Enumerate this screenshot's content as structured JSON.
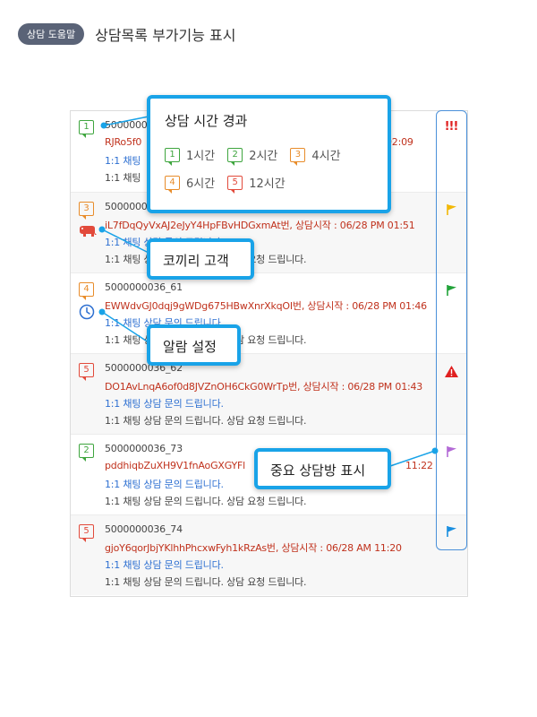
{
  "header": {
    "help_label": "상담 도움말",
    "title": "상담목록 부가기능 표시"
  },
  "items": [
    {
      "badge": "1",
      "id": "5000000036_",
      "name": "RJRo5f0",
      "time": "02:09",
      "msg1": "1:1 채팅",
      "msg2": "1:1 채팅"
    },
    {
      "badge": "3",
      "id": "5000000036_",
      "name": "iL7fDqQyVxAJ2eJyY4HpFBvHDGxmAt번, 상담시작 : 06/28 PM 01:51",
      "msg1": "1:1 채팅 상담 문의 드립니다.",
      "msg2": "1:1 채팅 상담 문의 드립니다. 상담 요청 드립니다."
    },
    {
      "badge": "4",
      "id": "5000000036_61",
      "name": "EWWdvGJ0dqj9gWDg675HBwXnrXkqOI번, 상담시작 : 06/28 PM 01:46",
      "msg1": "1:1 채팅 상담 문의 드립니다.",
      "msg2": "1:1 채팅 상담 문의 드립니다. 상담 요청 드립니다."
    },
    {
      "badge": "5",
      "id": "5000000036_62",
      "name": "DO1AvLnqA6of0d8JVZnOH6CkG0WrTp번, 상담시작 : 06/28 PM 01:43",
      "msg1": "1:1 채팅 상담 문의 드립니다.",
      "msg2": "1:1 채팅 상담 문의 드립니다. 상담 요청 드립니다."
    },
    {
      "badge": "2",
      "id": "5000000036_73",
      "name": "pddhiqbZuXH9V1fnAoGXGYFl",
      "time": "11:22",
      "msg1": "1:1 채팅 상담 문의 드립니다.",
      "msg2": "1:1 채팅 상담 문의 드립니다. 상담 요청 드립니다."
    },
    {
      "badge": "5",
      "id": "5000000036_74",
      "name": "gjoY6qorJbjYKlhhPhcxwFyh1kRzAs번, 상담시작 : 06/28 AM 11:20",
      "msg1": "1:1 채팅 상담 문의 드립니다.",
      "msg2": "1:1 채팅 상담 문의 드립니다. 상담 요청 드립니다."
    }
  ],
  "flags": {
    "exclaim": "!!!"
  },
  "callouts": {
    "time": {
      "title": "상담 시간 경과",
      "legend": [
        {
          "num": "1",
          "label": "1시간"
        },
        {
          "num": "2",
          "label": "2시간"
        },
        {
          "num": "3",
          "label": "4시간"
        },
        {
          "num": "4",
          "label": "6시간"
        },
        {
          "num": "5",
          "label": "12시간"
        }
      ]
    },
    "elephant": "코끼리 고객",
    "alarm": "알람 설정",
    "important": "중요 상담방 표시"
  },
  "colors": {
    "accent": "#19a3e8",
    "green": "#3ea53e",
    "orange": "#e88c2a",
    "red": "#e24a3b",
    "blue_text": "#2d6fd1",
    "purple_flag": "#b36ad6",
    "yellow_flag": "#f2b807"
  },
  "icons": [
    "elephant-icon",
    "alarm-clock-icon",
    "yellow-flag-icon",
    "green-flag-icon",
    "warning-icon",
    "purple-flag-icon",
    "blue-flag-icon"
  ]
}
